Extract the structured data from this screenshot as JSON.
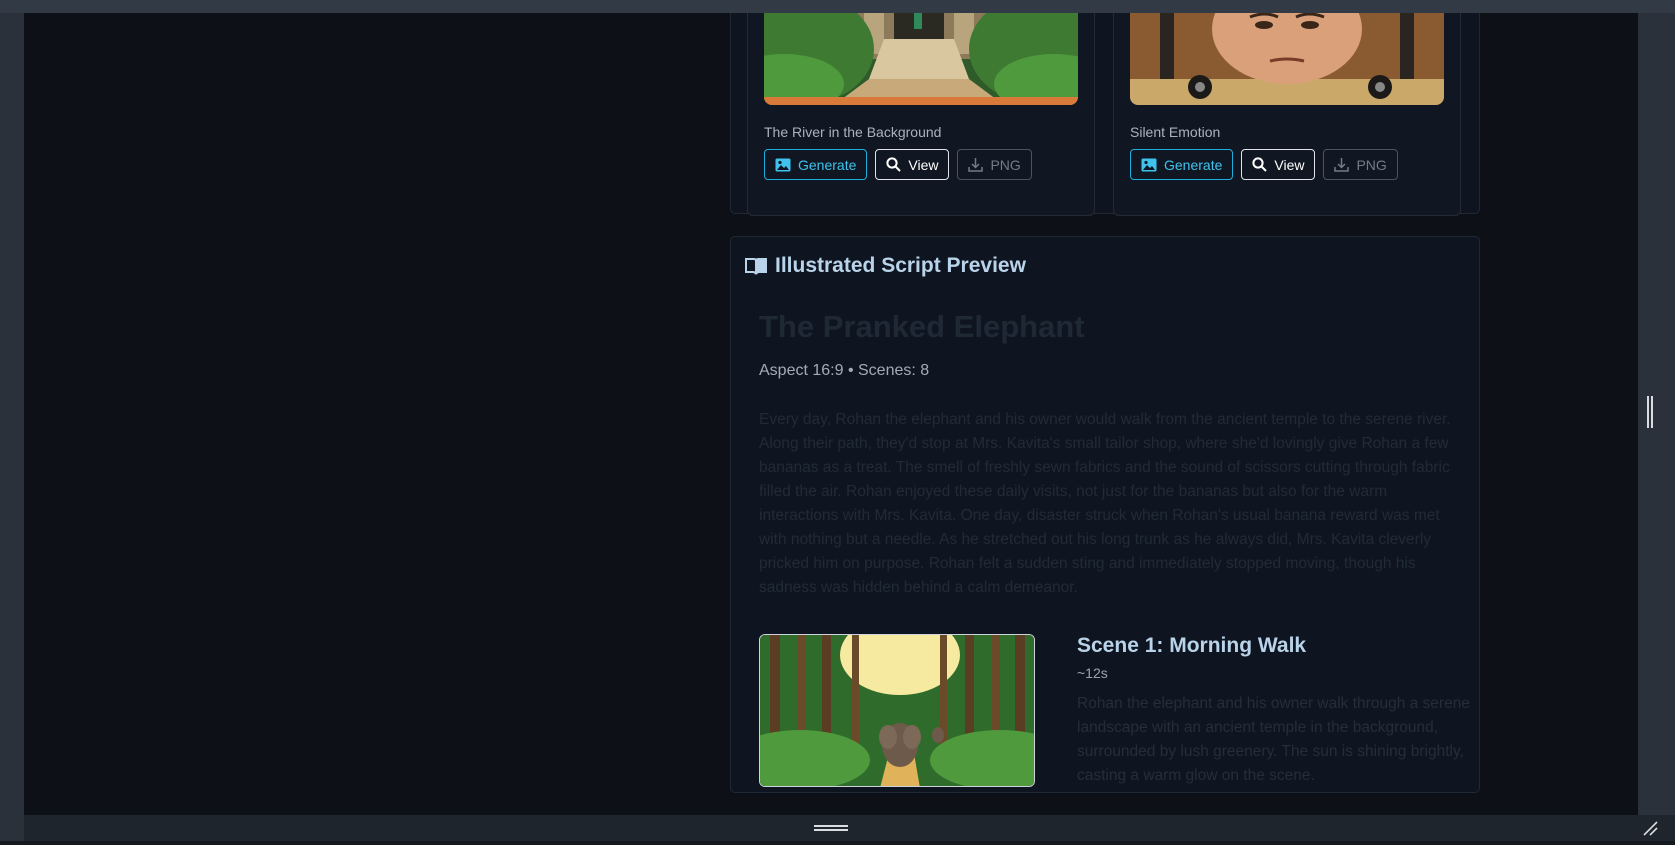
{
  "cards": [
    {
      "caption": "The River in the Background",
      "buttons": {
        "generate": "Generate",
        "view": "View",
        "png": "PNG"
      }
    },
    {
      "caption": "Silent Emotion",
      "buttons": {
        "generate": "Generate",
        "view": "View",
        "png": "PNG"
      }
    }
  ],
  "script_preview": {
    "heading": "Illustrated Script Preview",
    "heading_icon": "book-open-icon",
    "story_title": "The Pranked Elephant",
    "meta": "Aspect 16:9 • Scenes: 8",
    "summary": "Every day, Rohan the elephant and his owner would walk from the ancient temple to the serene river. Along their path, they'd stop at Mrs. Kavita's small tailor shop, where she'd lovingly give Rohan a few bananas as a treat. The smell of freshly sewn fabrics and the sound of scissors cutting through fabric filled the air. Rohan enjoyed these daily visits, not just for the bananas but also for the warm interactions with Mrs. Kavita. One day, disaster struck when Rohan's usual banana reward was met with nothing but a needle. As he stretched out his long trunk as he always did, Mrs. Kavita cleverly pricked him on purpose. Rohan felt a sudden sting and immediately stopped moving, though his sadness was hidden behind a calm demeanor.",
    "scenes": [
      {
        "title": "Scene 1: Morning Walk",
        "duration": "~12s",
        "description": "Rohan the elephant and his owner walk through a serene landscape with an ancient temple in the background, surrounded by lush greenery. The sun is shining brightly, casting a warm glow on the scene."
      }
    ]
  },
  "colors": {
    "accent": "#1eaedb",
    "heading": "#b9d3ea",
    "background": "#0d1117",
    "panel": "#0f1520"
  }
}
